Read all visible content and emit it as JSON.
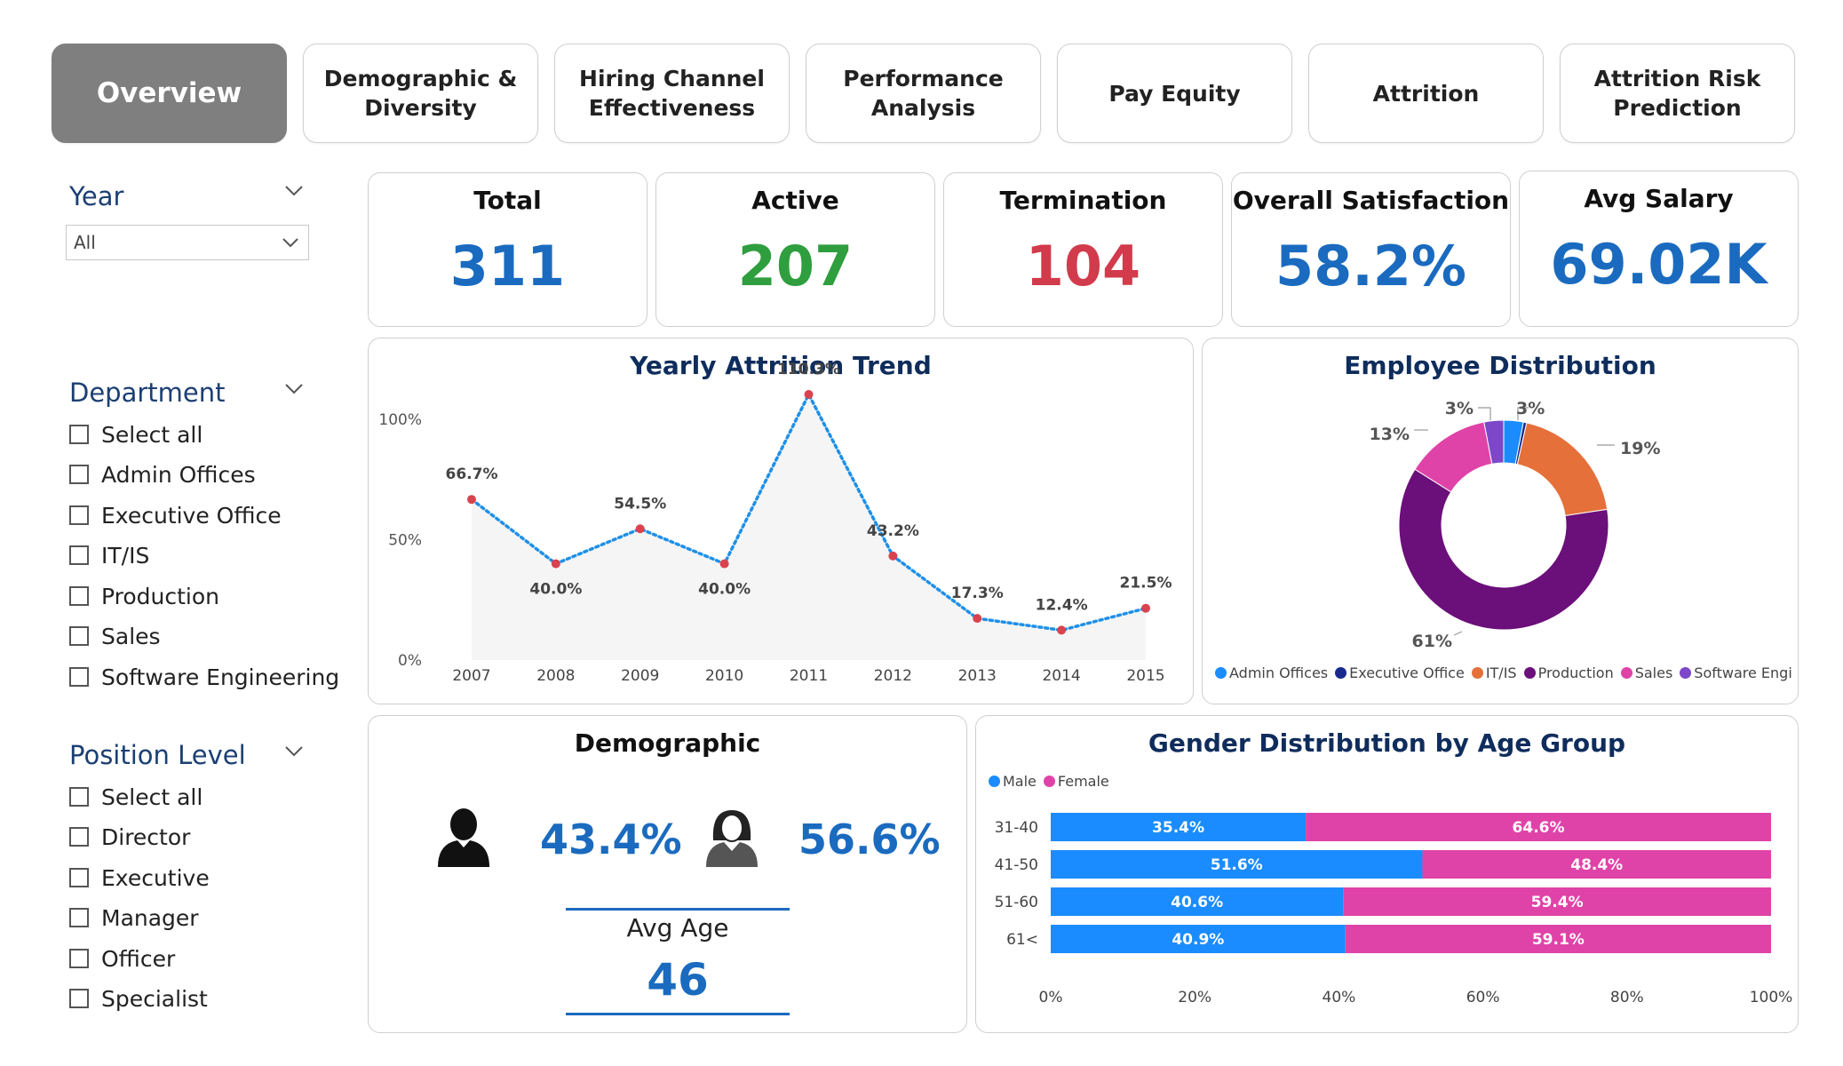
{
  "tabs": [
    {
      "label": "Overview",
      "active": true
    },
    {
      "label": "Demographic & Diversity",
      "active": false
    },
    {
      "label": "Hiring Channel Effectiveness",
      "active": false
    },
    {
      "label": "Performance Analysis",
      "active": false
    },
    {
      "label": "Pay Equity",
      "active": false
    },
    {
      "label": "Attrition",
      "active": false
    },
    {
      "label": "Attrition Risk Prediction",
      "active": false
    }
  ],
  "filters": {
    "year": {
      "title": "Year",
      "value": "All"
    },
    "department": {
      "title": "Department",
      "options": [
        "Select all",
        "Admin Offices",
        "Executive Office",
        "IT/IS",
        "Production",
        "Sales",
        "Software Engineering"
      ]
    },
    "position_level": {
      "title": "Position Level",
      "options": [
        "Select all",
        "Director",
        "Executive",
        "Manager",
        "Officer",
        "Specialist"
      ]
    }
  },
  "kpis": [
    {
      "title": "Total",
      "value": "311",
      "color": "#1a6bbf"
    },
    {
      "title": "Active",
      "value": "207",
      "color": "#2e9e3e"
    },
    {
      "title": "Termination",
      "value": "104",
      "color": "#d13b4b"
    },
    {
      "title": "Overall Satisfaction",
      "value": "58.2%",
      "color": "#1a6bbf"
    },
    {
      "title": "Avg Salary",
      "value": "69.02K",
      "color": "#1a6bbf"
    }
  ],
  "attrition_chart": {
    "title": "Yearly Attrition Trend",
    "y_ticks": [
      "100%",
      "50%",
      "0%"
    ],
    "chart_data": {
      "type": "area",
      "x": [
        "2007",
        "2008",
        "2009",
        "2010",
        "2011",
        "2012",
        "2013",
        "2014",
        "2015"
      ],
      "values": [
        66.7,
        40.0,
        54.5,
        40.0,
        110.3,
        43.2,
        17.3,
        12.4,
        21.5
      ],
      "labels": [
        "66.7%",
        "40.0%",
        "54.5%",
        "40.0%",
        "110.3%",
        "43.2%",
        "17.3%",
        "12.4%",
        "21.5%"
      ],
      "ylim": [
        0,
        110.3
      ],
      "line_color": "#1e90e8",
      "marker_color": "#d9434f"
    }
  },
  "distribution_chart": {
    "title": "Employee Distribution",
    "chart_data": {
      "type": "pie",
      "categories": [
        "Admin Offices",
        "Executive Office",
        "IT/IS",
        "Production",
        "Sales",
        "Software Engi..."
      ],
      "values": [
        3,
        0.5,
        19,
        61,
        13,
        3
      ],
      "labels": [
        "3%",
        "",
        "19%",
        "61%",
        "13%",
        "3%"
      ],
      "colors": [
        "#1a8cff",
        "#1a2a8c",
        "#e5703a",
        "#6b0f7a",
        "#e043a8",
        "#7d47c9"
      ]
    }
  },
  "demographic": {
    "title": "Demographic",
    "male_pct": "43.4%",
    "female_pct": "56.6%",
    "avg_age_label": "Avg Age",
    "avg_age": "46"
  },
  "gender_chart": {
    "title": "Gender Distribution by Age Group",
    "x_ticks": [
      "0%",
      "20%",
      "40%",
      "60%",
      "80%",
      "100%"
    ],
    "chart_data": {
      "type": "bar",
      "stacked": true,
      "orientation": "horizontal",
      "categories": [
        "31-40",
        "41-50",
        "51-60",
        "61<"
      ],
      "series": [
        {
          "name": "Male",
          "values": [
            35.4,
            51.6,
            40.6,
            40.9
          ],
          "labels": [
            "35.4%",
            "51.6%",
            "40.6%",
            "40.9%"
          ],
          "color": "#1a8cff"
        },
        {
          "name": "Female",
          "values": [
            64.6,
            48.4,
            59.4,
            59.1
          ],
          "labels": [
            "64.6%",
            "48.4%",
            "59.4%",
            "59.1%"
          ],
          "color": "#e043a8"
        }
      ],
      "xlim": [
        0,
        100
      ]
    }
  }
}
